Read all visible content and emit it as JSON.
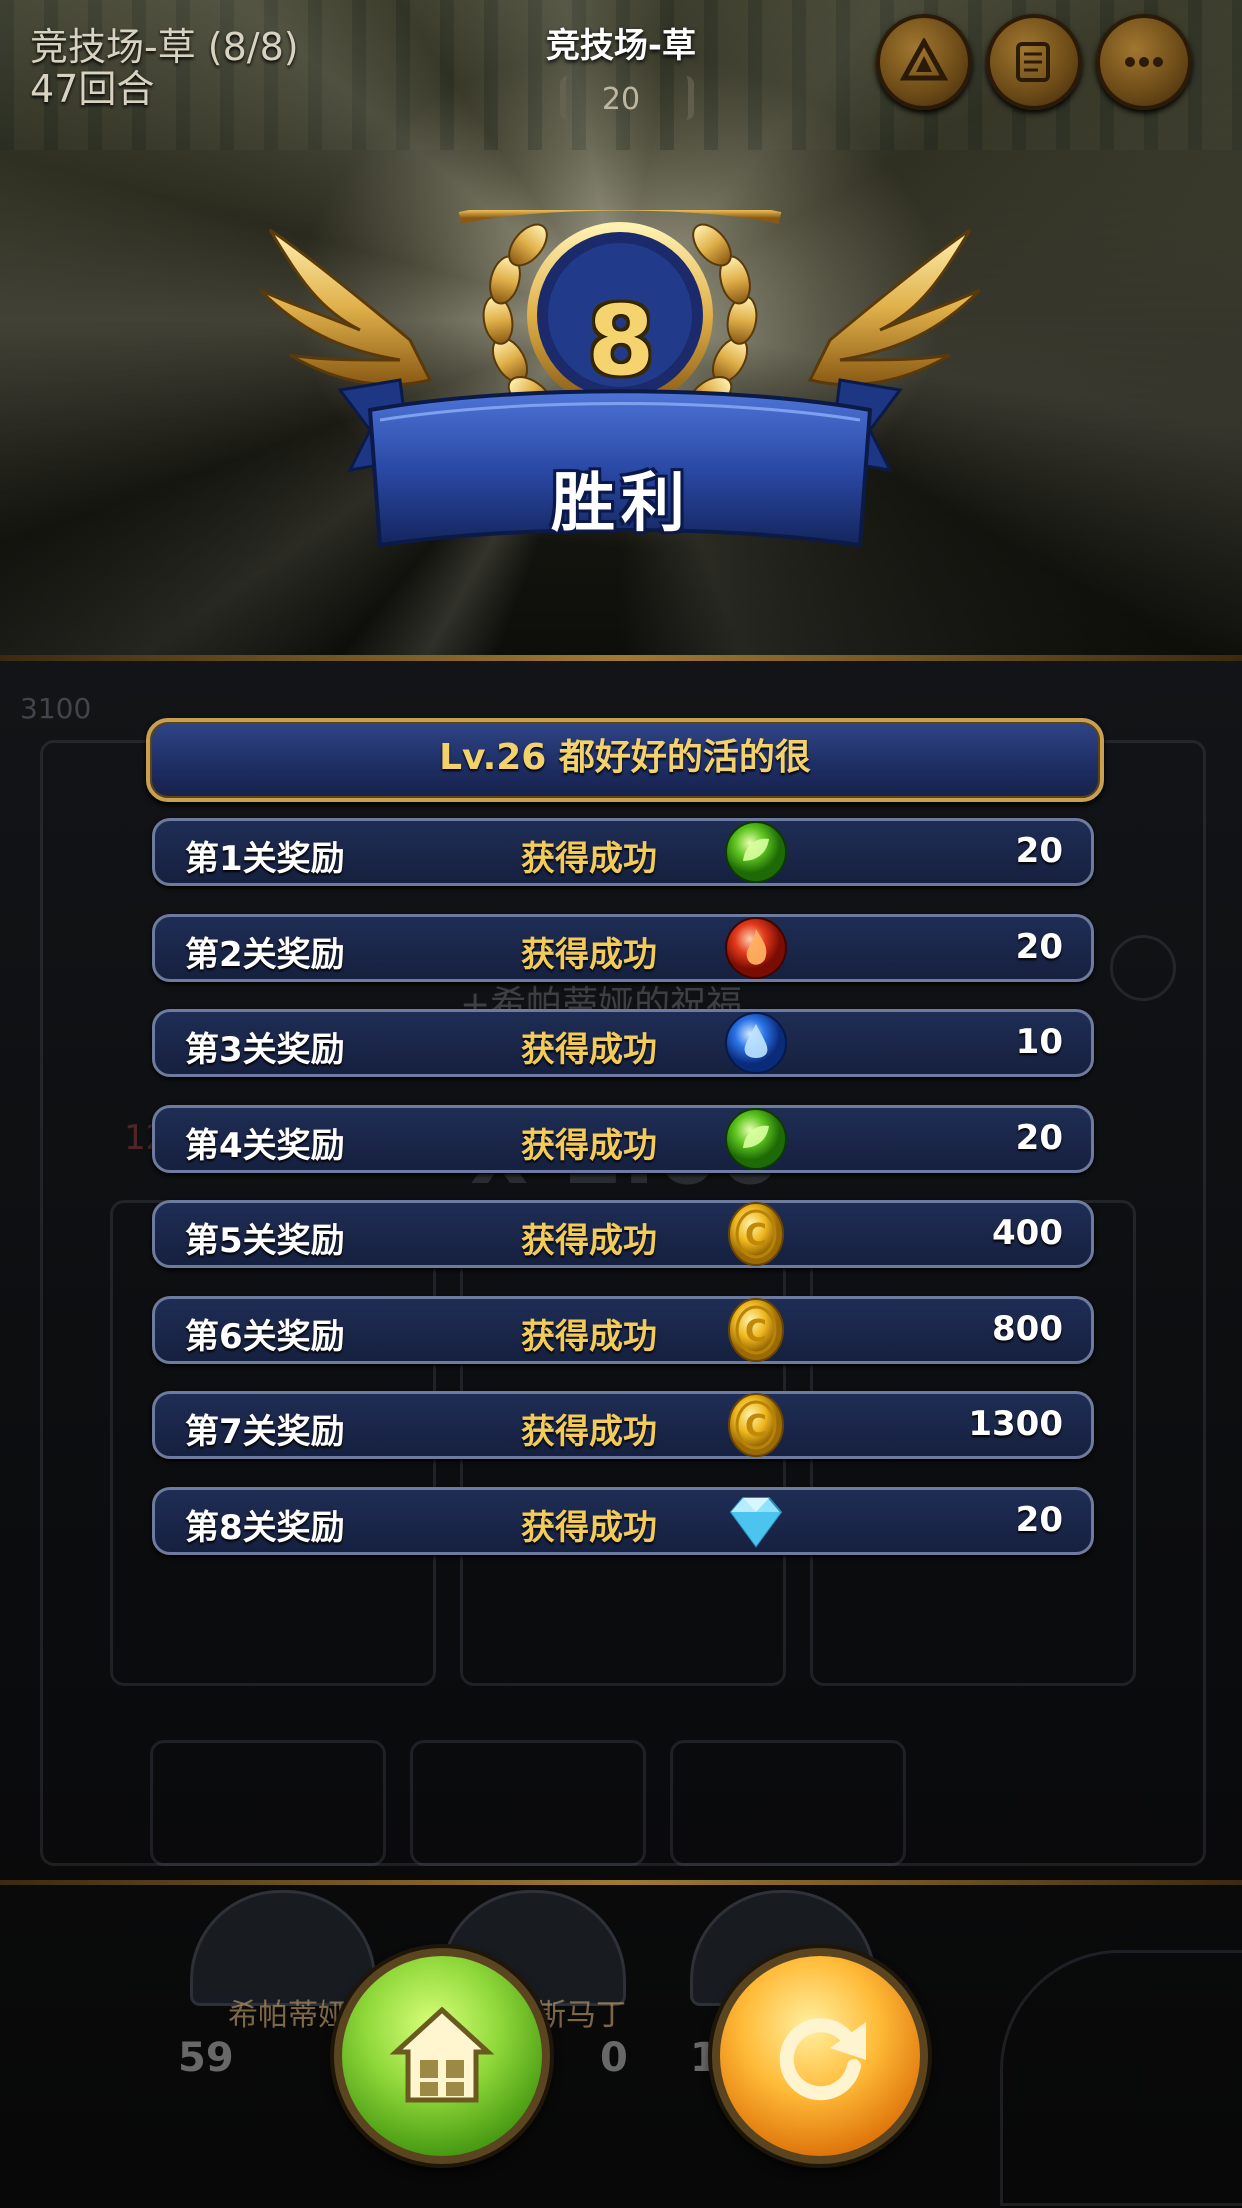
{
  "header": {
    "stage_title": "竞技场-草 (8/8)",
    "round": "47回合",
    "title": "竞技场-草",
    "counter": "20",
    "buttons": [
      "arena-icon",
      "scroll-icon",
      "more-icon"
    ]
  },
  "result": {
    "level": "8",
    "label": "胜利"
  },
  "rewards": {
    "header": "Lv.26  都好好的活的很",
    "rows": [
      {
        "label": "第1关奖励",
        "status": "获得成功",
        "icon": "green-leaf-orb-icon",
        "value": "20"
      },
      {
        "label": "第2关奖励",
        "status": "获得成功",
        "icon": "red-fire-orb-icon",
        "value": "20"
      },
      {
        "label": "第3关奖励",
        "status": "获得成功",
        "icon": "blue-water-orb-icon",
        "value": "10"
      },
      {
        "label": "第4关奖励",
        "status": "获得成功",
        "icon": "green-leaf-orb-icon",
        "value": "20"
      },
      {
        "label": "第5关奖励",
        "status": "获得成功",
        "icon": "gold-coin-icon",
        "value": "400"
      },
      {
        "label": "第6关奖励",
        "status": "获得成功",
        "icon": "gold-coin-icon",
        "value": "800"
      },
      {
        "label": "第7关奖励",
        "status": "获得成功",
        "icon": "gold-coin-icon",
        "value": "1300"
      },
      {
        "label": "第8关奖励",
        "status": "获得成功",
        "icon": "diamond-icon",
        "value": "20"
      }
    ]
  },
  "background": {
    "score_left": "3100",
    "blessing": "+希帕蒂娅的祝福",
    "multiplier": "x 1.00",
    "level_badge": "12",
    "char1_name": "希帕蒂娅",
    "char2_name": "斯马丁",
    "char1_num": "59",
    "char2_num": "0",
    "char3_num": "1"
  },
  "actions": {
    "home": "home-icon",
    "retry": "retry-icon"
  },
  "colors": {
    "gold": "#f2cb58",
    "panel_blue": "#1f2d55",
    "ribbon_blue": "#2b49a6",
    "home_green": "#8fd83a",
    "retry_orange": "#ffbb38"
  }
}
